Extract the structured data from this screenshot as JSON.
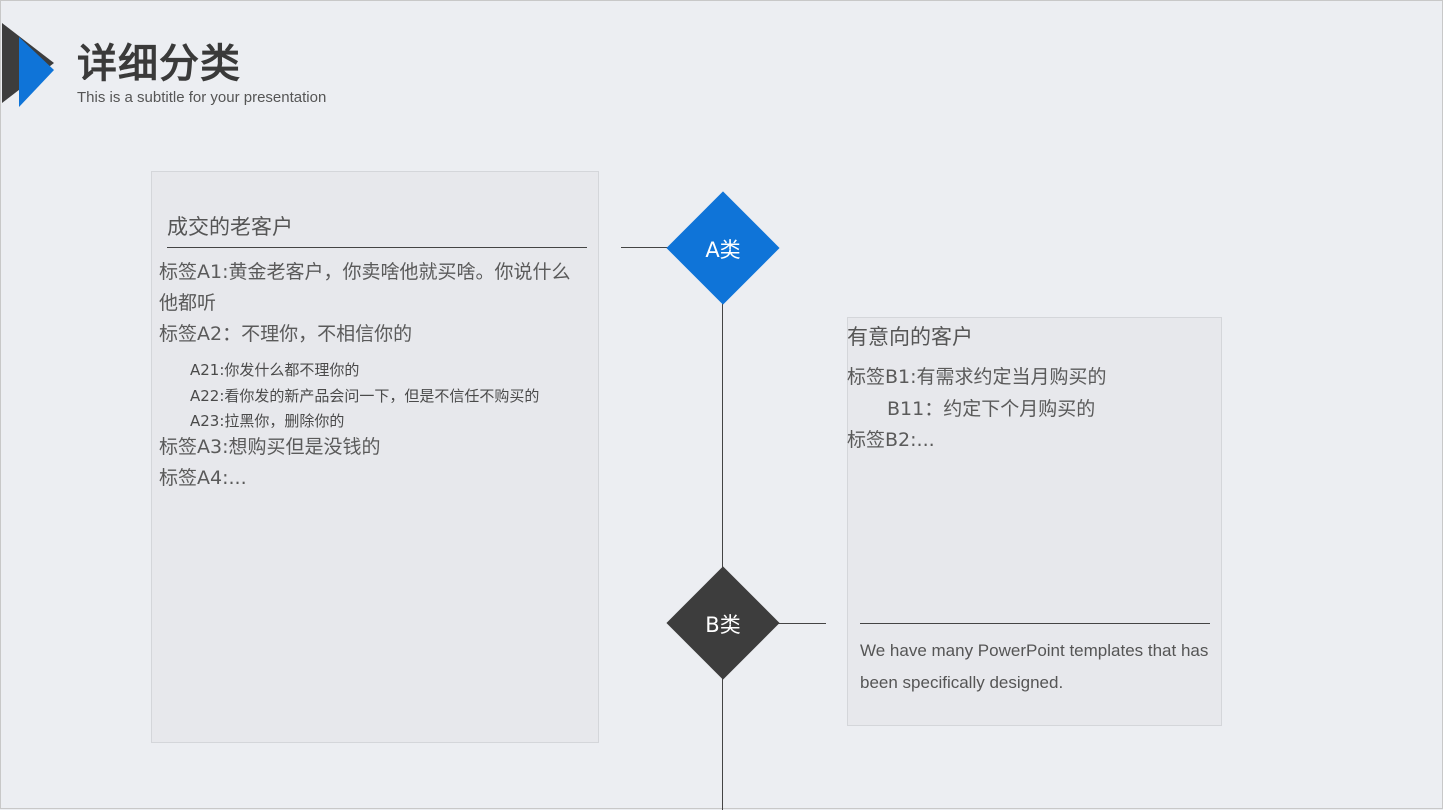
{
  "header": {
    "title": "详细分类",
    "subtitle": "This is a subtitle for your presentation"
  },
  "colors": {
    "accent": "#0f74d8",
    "dark": "#3d3d3d",
    "background": "#eceef2",
    "card": "#e7e8ec"
  },
  "diamonds": {
    "a_label": "A类",
    "b_label": "B类"
  },
  "card_a": {
    "title": "成交的老客户",
    "line1": "标签A1:黄金老客户，你卖啥他就买啥。你说什么",
    "line2": "他都听",
    "line3": "标签A2：不理你，不相信你的",
    "sub1": "A21:你发什么都不理你的",
    "sub2": "A22:看你发的新产品会问一下，但是不信任不购买的",
    "sub3": "A23:拉黑你，删除你的",
    "line4": "标签A3:想购买但是没钱的",
    "line5": "标签A4:..."
  },
  "card_b": {
    "title": "有意向的客户",
    "line1": "标签B1:有需求约定当月购买的",
    "line2": "B11：约定下个月购买的",
    "line3": "标签B2:...",
    "description": "We have many PowerPoint templates that has been specifically designed."
  }
}
